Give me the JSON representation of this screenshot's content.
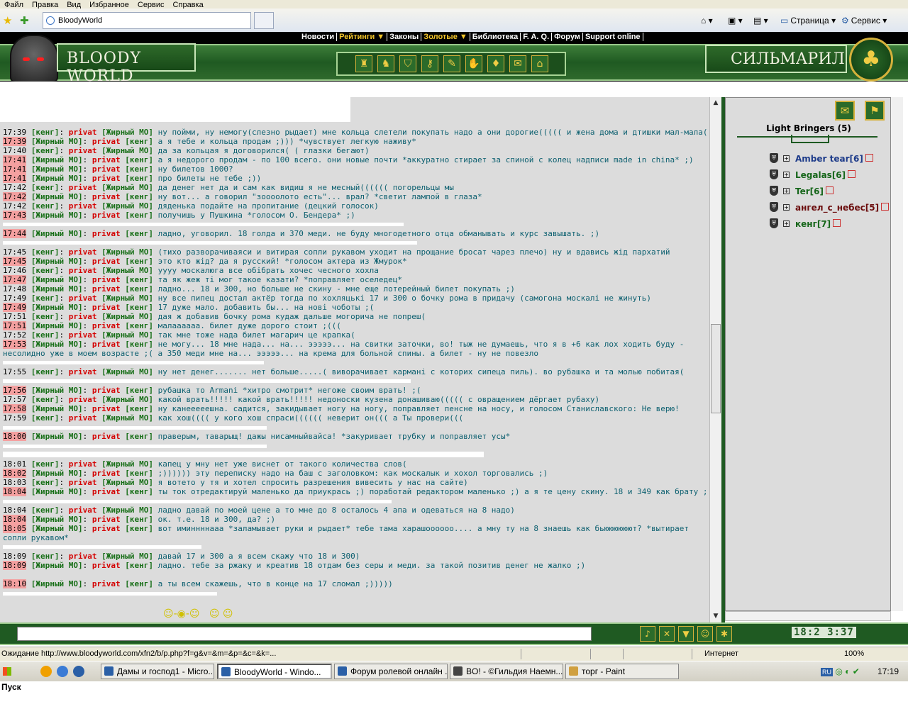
{
  "ie": {
    "menu": [
      "Файл",
      "Правка",
      "Вид",
      "Избранное",
      "Сервис",
      "Справка"
    ],
    "tab_title": "BloodyWorld",
    "cmd_page": "Страница",
    "cmd_service": "Сервис"
  },
  "site": {
    "nav": [
      "Новости",
      "Рейтинги ▼",
      "Законы",
      "Золотые ▼",
      "Библиотека",
      "F. A. Q.",
      "Форум",
      "Support online"
    ],
    "logo_left": "BLOODY WORLD",
    "logo_right": "СИЛЬМАРИЛ"
  },
  "chat": {
    "messages": [
      {
        "time": "17:39",
        "from": "[кенг]",
        "priv": "privat",
        "to": "[Жирный МО]",
        "text": "ну пойми, ну немогу(слезно рыдает) мне кольца слетели покупать надо а они дорогие((((( и жена дома и дтишки мал-мала(((((",
        "me": false
      },
      {
        "time": "17:39",
        "from": "[Жирный МО]",
        "priv": "privat",
        "to": "[кенг]",
        "text": "а я тебе и кольца продам ;))) *чувствует легкую наживу*",
        "me": true
      },
      {
        "time": "17:40",
        "from": "[кенг]",
        "priv": "privat",
        "to": "[Жирный МО]",
        "text": "да за кольцая я договорился( ( глазки бегают)",
        "me": false
      },
      {
        "time": "17:41",
        "from": "[Жирный МО]",
        "priv": "privat",
        "to": "[кенг]",
        "text": "а я недорого продам - по 100 всего. они новые почти *аккуратно стирает за спиной с колец надписи made in china* ;)",
        "me": true
      },
      {
        "time": "17:41",
        "from": "[Жирный МО]",
        "priv": "privat",
        "to": "[кенг]",
        "text": "ну билетов 1000?",
        "me": true
      },
      {
        "time": "17:41",
        "from": "[Жирный МО]",
        "priv": "privat",
        "to": "[кенг]",
        "text": "про билеты не тебе ;))",
        "me": true
      },
      {
        "time": "17:42",
        "from": "[кенг]",
        "priv": "privat",
        "to": "[Жирный МО]",
        "text": "да денег нет да и сам как видиш я не месный(((((( погорельцы мы",
        "me": false
      },
      {
        "time": "17:42",
        "from": "[Жирный МО]",
        "priv": "privat",
        "to": "[кенг]",
        "text": "ну вот... а говорил \"зоооолото есть\"... врал? *светит лампой в глаза*",
        "me": true
      },
      {
        "time": "17:42",
        "from": "[кенг]",
        "priv": "privat",
        "to": "[Жирный МО]",
        "text": "дяденька подайте на пропитание (децкий голосок)",
        "me": false
      },
      {
        "time": "17:43",
        "from": "[Жирный МО]",
        "priv": "privat",
        "to": "[кенг]",
        "text": "получишь у Пушкина *голосом О. Бендера* ;)",
        "me": true
      },
      {
        "time": "17:44",
        "from": "[Жирный МО]",
        "priv": "privat",
        "to": "[кенг]",
        "text": "ладно, уговорил. 18 голда и 370 меди. не буду многодетного отца обманывать и курс завышать. ;)",
        "me": true
      },
      {
        "time": "17:45",
        "from": "[кенг]",
        "priv": "privat",
        "to": "[Жирный МО]",
        "text": "(тихо разворачиваяси и витирая сопли рукавом уходит на прощание бросат чарез плечо) ну и вдавись жід пархатий",
        "me": false
      },
      {
        "time": "17:45",
        "from": "[Жирный МО]",
        "priv": "privat",
        "to": "[кенг]",
        "text": "это кто жід? да я русский! *голосом актера из Жмурок*",
        "me": true
      },
      {
        "time": "17:46",
        "from": "[кенг]",
        "priv": "privat",
        "to": "[Жирный МО]",
        "text": "уууу москалюга все обібрать хочес чесного хохла",
        "me": false
      },
      {
        "time": "17:47",
        "from": "[Жирный МО]",
        "priv": "privat",
        "to": "[кенг]",
        "text": "та як жеж ті мог такое казати? *поправляет оселедец*",
        "me": true
      },
      {
        "time": "17:48",
        "from": "[Жирный МО]",
        "priv": "privat",
        "to": "[кенг]",
        "text": "ладно... 18 и 300, но больше не скину - мне еще лотерейный билет покупать ;)",
        "me": false
      },
      {
        "time": "17:49",
        "from": "[кенг]",
        "priv": "privat",
        "to": "[Жирный МО]",
        "text": "ну все пипец достал актёр тогда по хохляцькі 17 и 300 о бочку рома в придачу (самогона москалі не жинуть)",
        "me": false
      },
      {
        "time": "17:49",
        "from": "[Жирный МО]",
        "priv": "privat",
        "to": "[кенг]",
        "text": "17 дуже мало. добавить бы... на нові чоботы ;(",
        "me": true
      },
      {
        "time": "17:51",
        "from": "[кенг]",
        "priv": "privat",
        "to": "[Жирный МО]",
        "text": "дая ж добавив бочку рома кудаж дальше могорича не попреш(",
        "me": false
      },
      {
        "time": "17:51",
        "from": "[Жирный МО]",
        "priv": "privat",
        "to": "[кенг]",
        "text": "малаааааа. билет дуже дорого стоит ;(((",
        "me": true
      },
      {
        "time": "17:52",
        "from": "[кенг]",
        "priv": "privat",
        "to": "[Жирный МО]",
        "text": "так мне тоже нада билет магарич це крапка(",
        "me": false
      },
      {
        "time": "17:53",
        "from": "[Жирный МО]",
        "priv": "privat",
        "to": "[кенг]",
        "text": "не могу... 18 мне нада... на... эээээ... на свитки заточки, во! тыж не думаешь, что я в +6 как лох ходить буду - несолидно уже в моем возрасте ;( а 350 меди мне на... эээээ... на крема для больной спины. а билет - ну не повезло",
        "me": true
      },
      {
        "time": "17:55",
        "from": "[кенг]",
        "priv": "privat",
        "to": "[Жирный МО]",
        "text": "ну нет денег....... нет больше.....( виворачивает кармані с которих сипеца пиль). во рубашка и та молью побитая(",
        "me": false
      },
      {
        "time": "17:56",
        "from": "[Жирный МО]",
        "priv": "privat",
        "to": "[кенг]",
        "text": "рубашка то Armani *хитро смотрит* негоже своим врать! ;(",
        "me": true
      },
      {
        "time": "17:57",
        "from": "[кенг]",
        "priv": "privat",
        "to": "[Жирный МО]",
        "text": "какой врать!!!!! какой врать!!!!! недоноски кузена донашиваю((((( с овращением дёргает рубаху)",
        "me": false
      },
      {
        "time": "17:58",
        "from": "[Жирный МО]",
        "priv": "privat",
        "to": "[кенг]",
        "text": "ну канееееешна. садится, закидывает ногу на ногу, поправляет пенсне на носу, и голосом Станиславского: Не верю!",
        "me": true
      },
      {
        "time": "17:59",
        "from": "[кенг]",
        "priv": "privat",
        "to": "[Жирный МО]",
        "text": "как хош(((( у кого хош спраси(((((( неверит он((( а Ты провери(((",
        "me": false
      },
      {
        "time": "18:00",
        "from": "[Жирный МО]",
        "priv": "privat",
        "to": "[кенг]",
        "text": "праверым, таварыщ! дажы нисамныйвайса! *закуривает трубку и поправляет усы*",
        "me": true
      },
      {
        "time": "18:01",
        "from": "[кенг]",
        "priv": "privat",
        "to": "[Жирный МО]",
        "text": "капец у мну нет уже виснет от такого количества слов(",
        "me": false
      },
      {
        "time": "18:02",
        "from": "[Жирный МО]",
        "priv": "privat",
        "to": "[кенг]",
        "text": ";)))))) эту переписку надо на баш с заголовком: как москалык и хохол торговались ;)",
        "me": true
      },
      {
        "time": "18:03",
        "from": "[кенг]",
        "priv": "privat",
        "to": "[Жирный МО]",
        "text": "я вотето у тя и хотел спросить разрешения вивесить у нас на сайте)",
        "me": false
      },
      {
        "time": "18:04",
        "from": "[Жирный МО]",
        "priv": "privat",
        "to": "[кенг]",
        "text": "ты ток отредактируй маленько да приукрась ;) поработай редактором маленько ;) а я те цену скину. 18 и 349 как брату ;)",
        "me": true
      },
      {
        "time": "18:04",
        "from": "[кенг]",
        "priv": "privat",
        "to": "[Жирный МО]",
        "text": "ладно давай по моей цене а то мне до 8 осталось 4 апа и одеваться на 8 надо)",
        "me": false
      },
      {
        "time": "18:04",
        "from": "[Жирный МО]",
        "priv": "privat",
        "to": "[кенг]",
        "text": "ок. т.е. 18 и 300, да? ;)",
        "me": true
      },
      {
        "time": "18:05",
        "from": "[Жирный МО]",
        "priv": "privat",
        "to": "[кенг]",
        "text": "вот иминнннааа *заламывает руки и рыдает* тебе тама харашоооооо.... а мну ту на 8 знаешь как бьюююююют? *вытирает сопли рукавом*",
        "me": true
      },
      {
        "time": "18:09",
        "from": "[кенг]",
        "priv": "privat",
        "to": "[Жирный МО]",
        "text": "давай 17 и 300 а я всем скажу что 18 и 300)",
        "me": false
      },
      {
        "time": "18:09",
        "from": "[Жирный МО]",
        "priv": "privat",
        "to": "[кенг]",
        "text": "ладно. тебе за ржаку и креатив 18 отдам без серы и меди. за такой позитив денег не жалко ;)",
        "me": true
      },
      {
        "time": "18:10",
        "from": "[Жирный МО]",
        "priv": "privat",
        "to": "[кенг]",
        "text": "а ты всем скажешь, что в конце на 17 сломал ;)))))",
        "me": true
      }
    ]
  },
  "room": {
    "title": "Light Bringers (5)",
    "users": [
      {
        "name": "Amber tear[6]",
        "style": "blue"
      },
      {
        "name": "Legalas[6]",
        "style": "green"
      },
      {
        "name": "Ter[6]",
        "style": "green"
      },
      {
        "name": "ангел_с_небес[5]",
        "style": "dark"
      },
      {
        "name": "кенг[7]",
        "style": "green"
      }
    ]
  },
  "clock": "18:2 3:37",
  "status": {
    "text": "Ожидание http://www.bloodyworld.com/xfn2/b/p.php?f=g&v=&m=&p=&c=&k=...",
    "zone": "Интернет",
    "zoom": "100%"
  },
  "taskbar": {
    "start": "Пуск",
    "tasks": [
      "Дамы и господ1 - Micro...",
      "BloodyWorld - Windo...",
      "Форум ролевой онлайн ...",
      "BO! - ©Гильдия Наемн...",
      "торг - Paint"
    ],
    "lang": "RU",
    "time": "17:19"
  }
}
